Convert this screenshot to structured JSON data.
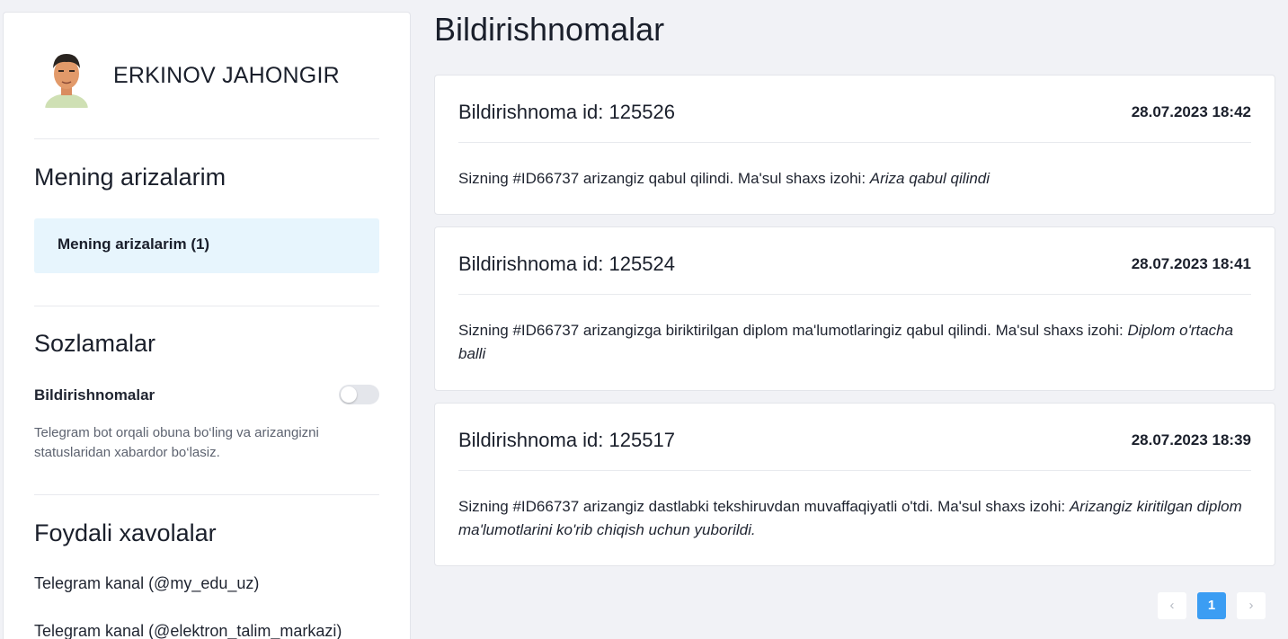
{
  "profile": {
    "name": "ERKINOV JAHONGIR"
  },
  "sidebar": {
    "applications_title": "Mening arizalarim",
    "applications_item": "Mening arizalarim (1)",
    "settings_title": "Sozlamalar",
    "notifications_label": "Bildirishnomalar",
    "notifications_enabled": false,
    "help_text": "Telegram bot orqali obuna bo‘ling va arizangizni statuslaridan xabardor bo‘lasiz.",
    "links_title": "Foydali xavolalar",
    "links": [
      "Telegram kanal (@my_edu_uz)",
      "Telegram kanal (@elektron_talim_markazi)"
    ]
  },
  "main": {
    "title": "Bildirishnomalar",
    "notifications": [
      {
        "id_label": "Bildirishnoma id: 125526",
        "date": "28.07.2023 18:42",
        "text": "Sizning #ID66737 arizangiz qabul qilindi. Ma'sul shaxs izohi: ",
        "comment": "Ariza qabul qilindi"
      },
      {
        "id_label": "Bildirishnoma id: 125524",
        "date": "28.07.2023 18:41",
        "text": "Sizning #ID66737 arizangizga biriktirilgan diplom ma'lumotlaringiz qabul qilindi. Ma'sul shaxs izohi: ",
        "comment": "Diplom o'rtacha balli"
      },
      {
        "id_label": "Bildirishnoma id: 125517",
        "date": "28.07.2023 18:39",
        "text": "Sizning #ID66737 arizangiz dastlabki tekshiruvdan muvaffaqiyatli o'tdi. Ma'sul shaxs izohi: ",
        "comment": "Arizangiz kiritilgan diplom ma'lumotlarini ko'rib chiqish uchun yuborildi."
      }
    ]
  },
  "pagination": {
    "prev": "‹",
    "current": "1",
    "next": "›"
  },
  "colors": {
    "accent": "#3b9df3",
    "selected_bg": "#e7f5fd",
    "page_bg": "#f1f2f6"
  }
}
